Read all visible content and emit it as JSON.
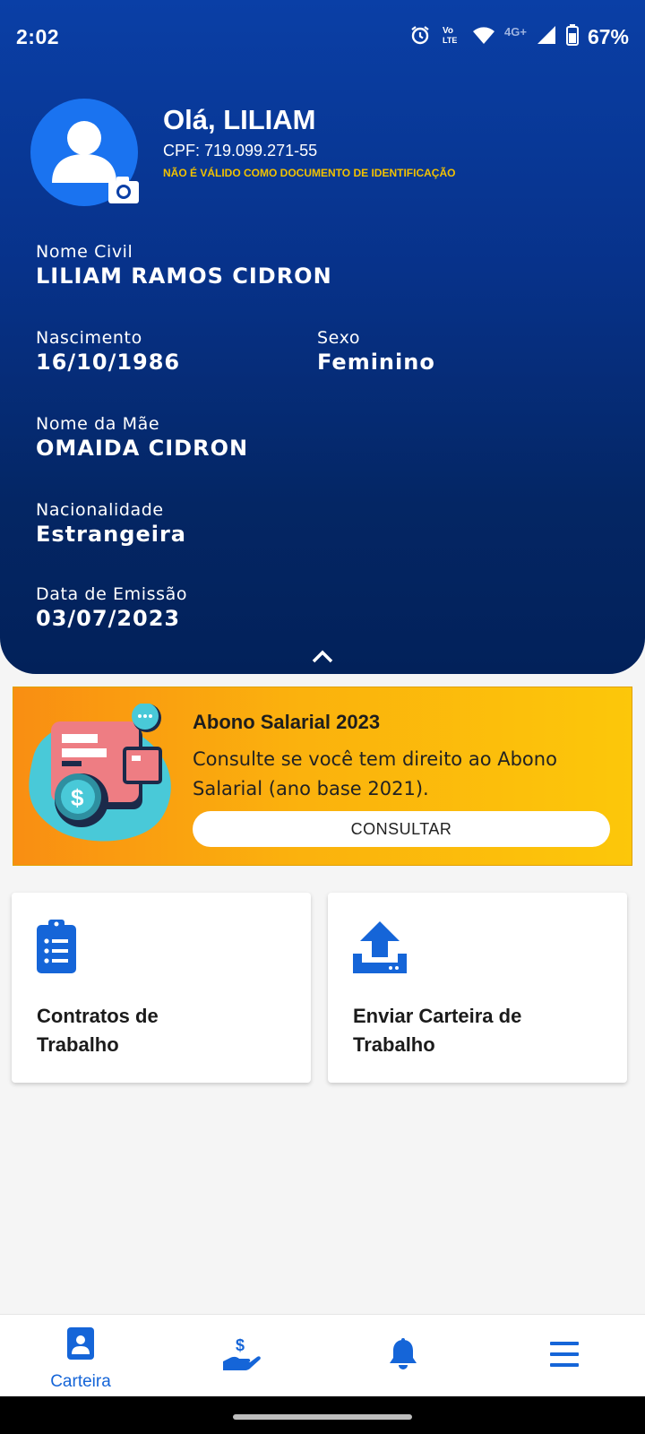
{
  "status_bar": {
    "time": "2:02",
    "network": "4G+",
    "volte": "Vo LTE",
    "battery": "67%"
  },
  "profile": {
    "greeting": "Olá, LILIAM",
    "cpf": "CPF: 719.099.271-55",
    "warning": "NÃO É VÁLIDO COMO DOCUMENTO DE IDENTIFICAÇÃO"
  },
  "fields": {
    "nome_civil": {
      "label": "Nome Civil",
      "value": "LILIAM RAMOS CIDRON"
    },
    "nascimento": {
      "label": "Nascimento",
      "value": "16/10/1986"
    },
    "sexo": {
      "label": "Sexo",
      "value": "Feminino"
    },
    "nome_mae": {
      "label": "Nome da Mãe",
      "value": "OMAIDA CIDRON"
    },
    "nacionalidade": {
      "label": "Nacionalidade",
      "value": "Estrangeira"
    },
    "emissao": {
      "label": "Data de Emissão",
      "value": "03/07/2023"
    }
  },
  "promo": {
    "title": "Abono Salarial 2023",
    "description": "Consulte se você tem direito ao Abono Salarial (ano base 2021).",
    "button_label": "CONSULTAR"
  },
  "cards": [
    {
      "title": "Contratos de Trabalho",
      "icon": "clipboard-list-icon"
    },
    {
      "title": "Enviar Carteira de Trabalho",
      "icon": "upload-tray-icon"
    }
  ],
  "bottom_nav": [
    {
      "label": "Carteira",
      "icon": "id-card-icon",
      "active": true
    },
    {
      "label": "",
      "icon": "hand-money-icon",
      "active": false
    },
    {
      "label": "",
      "icon": "bell-icon",
      "active": false
    },
    {
      "label": "",
      "icon": "menu-icon",
      "active": false
    }
  ],
  "colors": {
    "header_top": "#0a3fa6",
    "header_bottom": "#02215a",
    "accent_blue": "#1565d8",
    "warning_yellow": "#f2c200",
    "promo_orange": "#f98e12",
    "promo_yellow": "#fcc70a"
  }
}
